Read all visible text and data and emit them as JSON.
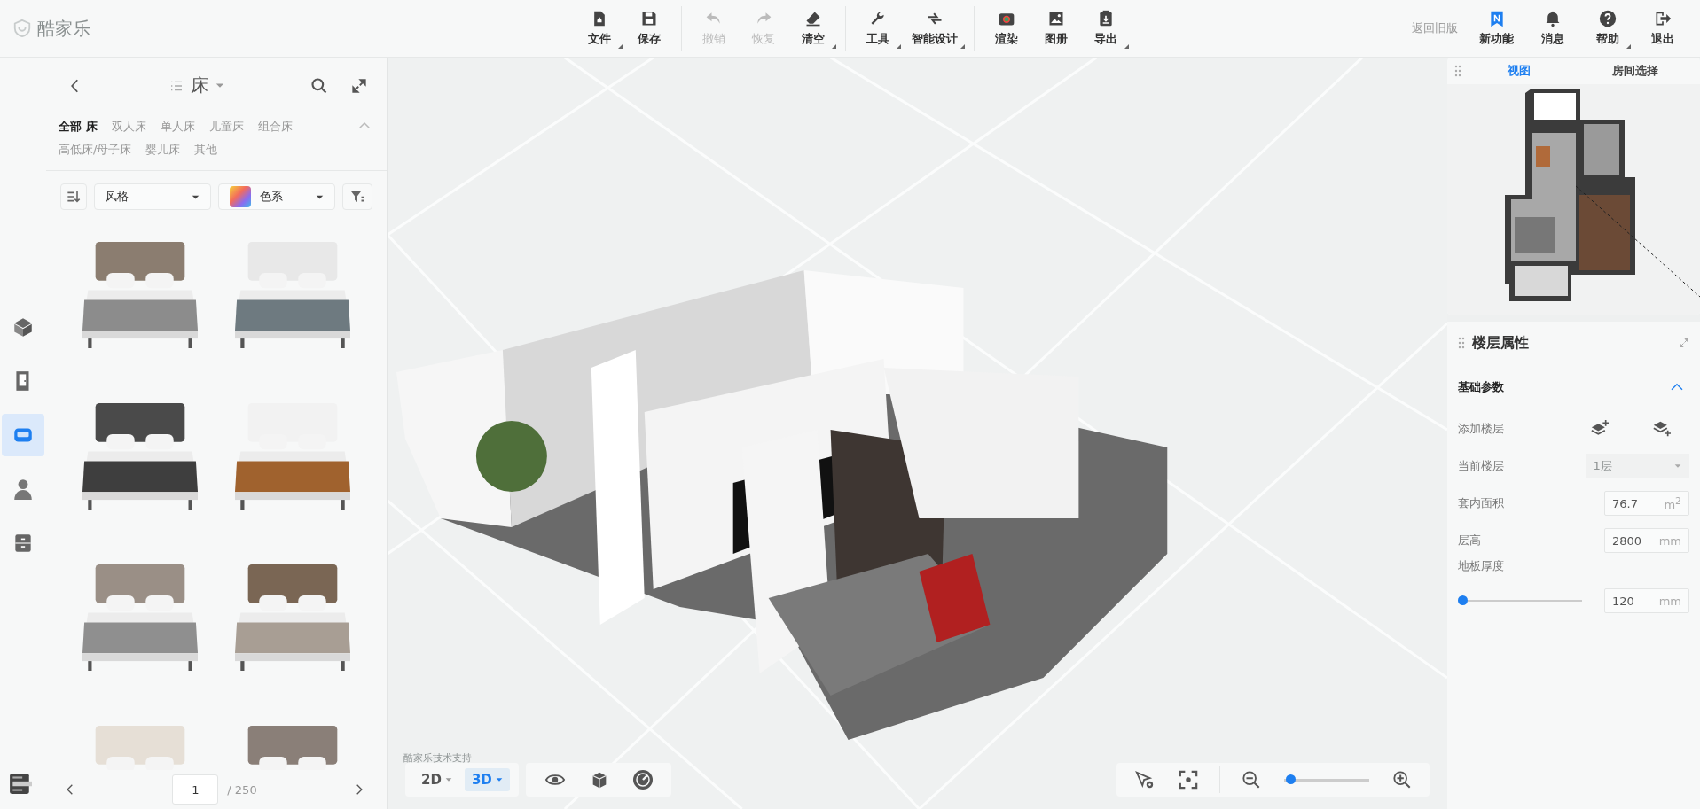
{
  "app": {
    "logo": "酷家乐"
  },
  "toolbar_groups": [
    {
      "buttons": [
        {
          "label": "文件",
          "has_menu": true,
          "disabled": false
        },
        {
          "label": "保存",
          "has_menu": false,
          "disabled": false
        }
      ]
    },
    {
      "buttons": [
        {
          "label": "撤销",
          "has_menu": false,
          "disabled": true
        },
        {
          "label": "恢复",
          "has_menu": false,
          "disabled": true
        },
        {
          "label": "清空",
          "has_menu": true,
          "disabled": false
        }
      ]
    },
    {
      "buttons": [
        {
          "label": "工具",
          "has_menu": true,
          "disabled": false
        },
        {
          "label": "智能设计",
          "has_menu": true,
          "disabled": false
        }
      ]
    },
    {
      "buttons": [
        {
          "label": "渲染",
          "has_menu": false,
          "disabled": false
        },
        {
          "label": "图册",
          "has_menu": false,
          "disabled": false
        },
        {
          "label": "导出",
          "has_menu": true,
          "disabled": false
        }
      ]
    }
  ],
  "header_right": {
    "legacy_link": "返回旧版",
    "buttons": [
      {
        "label": "新功能",
        "has_menu": false
      },
      {
        "label": "消息",
        "has_menu": false
      },
      {
        "label": "帮助",
        "has_menu": true
      },
      {
        "label": "退出",
        "has_menu": false
      }
    ]
  },
  "side_rail": [
    {
      "selected": false
    },
    {
      "selected": false
    },
    {
      "selected": true
    },
    {
      "selected": false
    },
    {
      "selected": false
    }
  ],
  "catalog": {
    "title": "床",
    "categories": [
      {
        "label": "全部 床",
        "selected": true
      },
      {
        "label": "双人床",
        "selected": false
      },
      {
        "label": "单人床",
        "selected": false
      },
      {
        "label": "儿童床",
        "selected": false
      },
      {
        "label": "组合床",
        "selected": false
      },
      {
        "label": "高低床/母子床",
        "selected": false
      },
      {
        "label": "婴儿床",
        "selected": false
      },
      {
        "label": "其他",
        "selected": false
      }
    ],
    "filters": [
      {
        "kind": "plain",
        "label": "风格"
      },
      {
        "kind": "swatch",
        "label": "色系"
      }
    ],
    "pagination": {
      "page": "1",
      "total": "/ 250"
    }
  },
  "canvas": {
    "credit": "酷家乐技术支持",
    "view_modes": [
      {
        "label": "2D",
        "selected": false
      },
      {
        "label": "3D",
        "selected": true
      }
    ],
    "zoom": {
      "level": 0.02
    }
  },
  "minimap": {
    "tabs": [
      {
        "label": "视图",
        "selected": true
      },
      {
        "label": "房间选择",
        "selected": false
      }
    ]
  },
  "floor_panel": {
    "title": "楼层属性",
    "section": {
      "title": "基础参数",
      "expanded": true
    },
    "rows": [
      {
        "kind": "icons",
        "label": "添加楼层"
      },
      {
        "kind": "select",
        "label": "当前楼层",
        "value": "1层",
        "disabled": true
      },
      {
        "kind": "input",
        "label": "套内面积",
        "value": "76.7",
        "unit": "m$^{2}$"
      },
      {
        "kind": "input",
        "label": "层高",
        "value": "2800",
        "unit": "mm"
      },
      {
        "kind": "slider",
        "label": "地板厚度",
        "level": 0,
        "value": "120",
        "unit": "mm"
      }
    ]
  }
}
